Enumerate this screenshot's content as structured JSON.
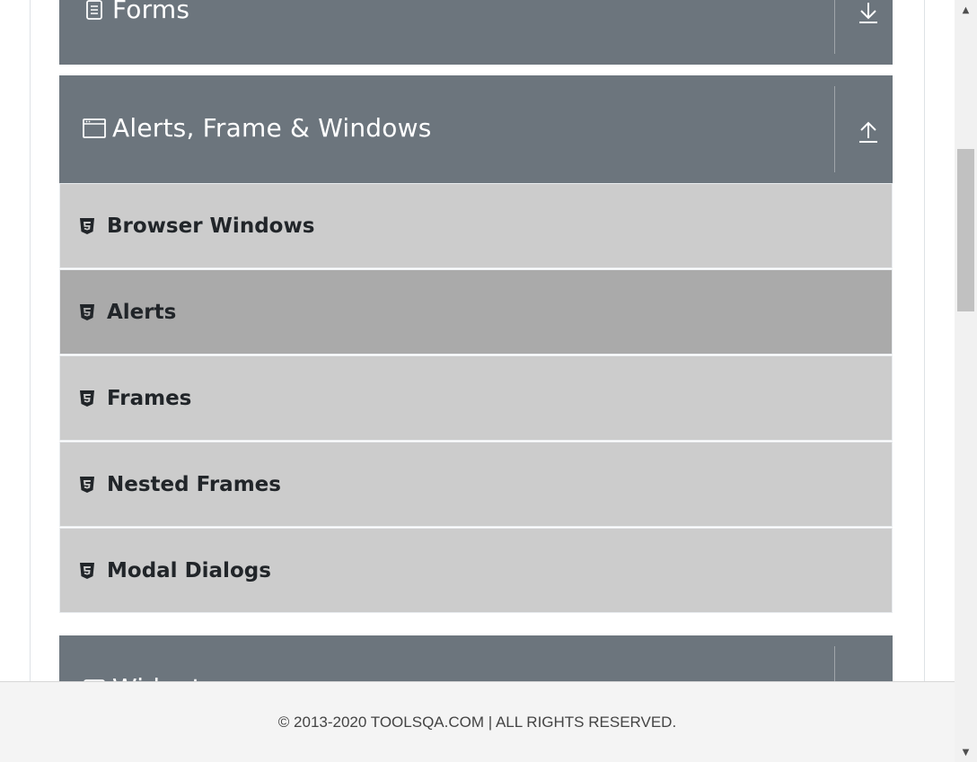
{
  "groups": {
    "forms": {
      "title": "Forms",
      "icon": "document-icon",
      "state": "collapsed"
    },
    "alerts": {
      "title": "Alerts, Frame & Windows",
      "icon": "window-icon",
      "state": "expanded"
    },
    "widgets": {
      "title": "Widgets",
      "icon": "widgets-icon",
      "state": "collapsed"
    }
  },
  "menu": {
    "items": [
      {
        "label": "Browser Windows",
        "icon": "html5-icon",
        "active": false
      },
      {
        "label": "Alerts",
        "icon": "html5-icon",
        "active": true
      },
      {
        "label": "Frames",
        "icon": "html5-icon",
        "active": false
      },
      {
        "label": "Nested Frames",
        "icon": "html5-icon",
        "active": false
      },
      {
        "label": "Modal Dialogs",
        "icon": "html5-icon",
        "active": false
      }
    ]
  },
  "footer": {
    "text": "© 2013-2020 TOOLSQA.COM | ALL RIGHTS RESERVED."
  },
  "colors": {
    "header_bg": "#6c757d",
    "item_bg": "#cccccc",
    "item_active_bg": "#aaaaaa",
    "footer_bg": "#f4f4f4"
  }
}
